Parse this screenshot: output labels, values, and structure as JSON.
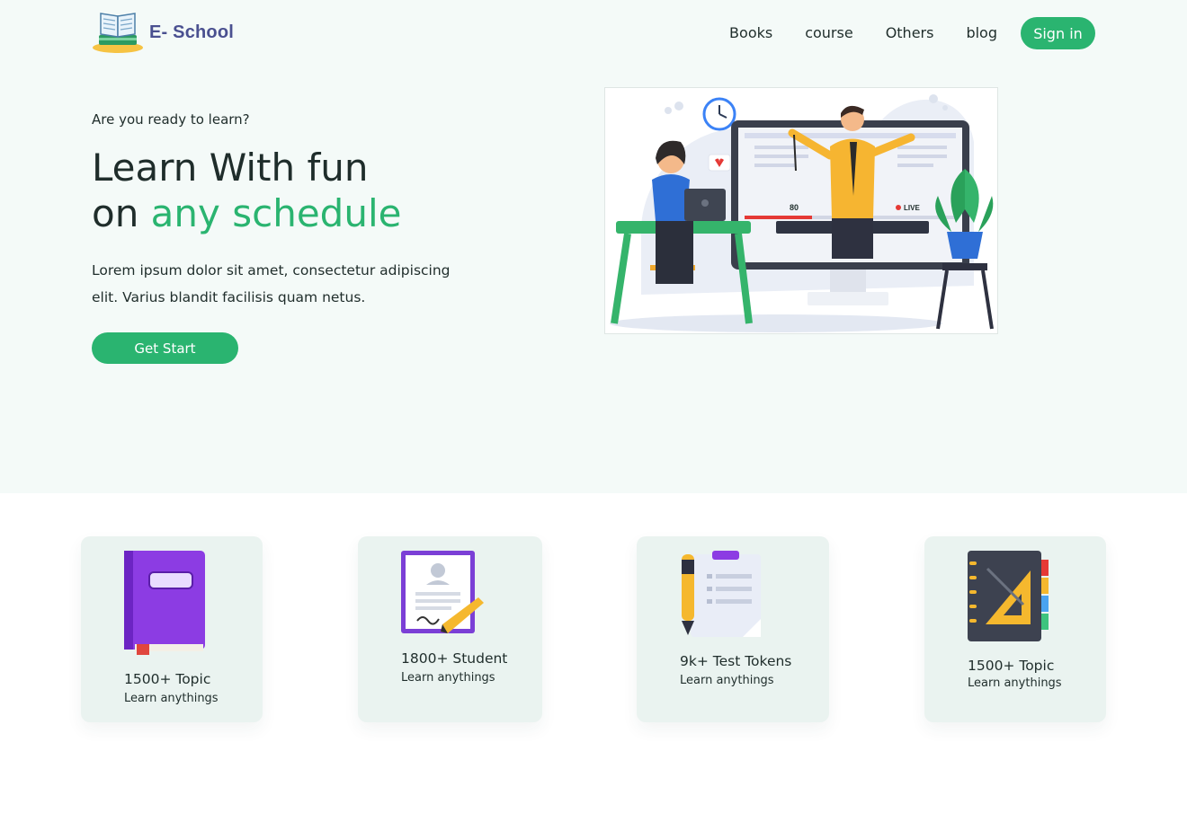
{
  "brand": {
    "name": "E- School",
    "logo_icon": "open-book-icon"
  },
  "nav": {
    "links": [
      {
        "label": "Books"
      },
      {
        "label": "course"
      },
      {
        "label": "Others"
      },
      {
        "label": "blog"
      }
    ],
    "signin_label": "Sign in"
  },
  "hero": {
    "eyebrow": "Are you ready to learn?",
    "title_line1": "Learn With fun",
    "title_line2_prefix": "on ",
    "title_line2_accent": "any schedule",
    "lead": "Lorem ipsum dolor sit amet, consectetur adipiscing elit. Varius blandit facilisis quam netus.",
    "cta_label": "Get Start",
    "illustration": {
      "icon": "online-teaching-illustration",
      "likes_count": "80",
      "live_label": "LIVE"
    }
  },
  "stats": [
    {
      "title": "1500+ Topic",
      "subtitle": "Learn anythings",
      "icon": "book-icon"
    },
    {
      "title": "1800+ Student",
      "subtitle": "Learn anythings",
      "icon": "certificate-pen-icon"
    },
    {
      "title": "9k+ Test Tokens",
      "subtitle": "Learn anythings",
      "icon": "clipboard-pen-icon"
    },
    {
      "title": "1500+ Topic",
      "subtitle": "Learn anythings",
      "icon": "notebook-ruler-icon"
    }
  ],
  "colors": {
    "accent": "#2ab470",
    "hero_background": "#f4faf8",
    "card_background": "#eaf3f0",
    "text": "#1f2d2b",
    "brand_text": "#4a5090"
  }
}
